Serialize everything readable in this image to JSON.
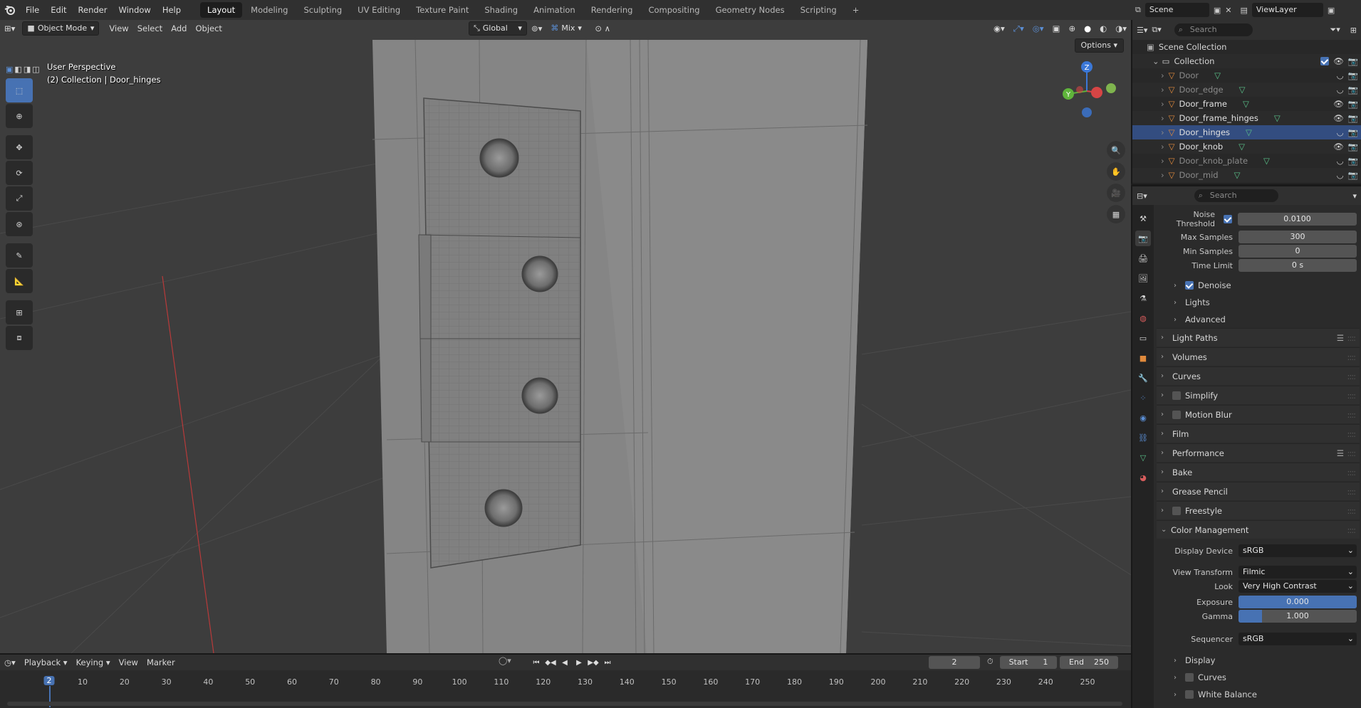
{
  "menubar": {
    "items": [
      "File",
      "Edit",
      "Render",
      "Window",
      "Help"
    ],
    "workspaces": [
      "Layout",
      "Modeling",
      "Sculpting",
      "UV Editing",
      "Texture Paint",
      "Shading",
      "Animation",
      "Rendering",
      "Compositing",
      "Geometry Nodes",
      "Scripting"
    ],
    "active_workspace": "Layout",
    "add_tab": "+"
  },
  "scenebar": {
    "scene": "Scene",
    "view_layer": "ViewLayer"
  },
  "viewport": {
    "mode": "Object Mode",
    "menus": [
      "View",
      "Select",
      "Add",
      "Object"
    ],
    "transform_orientation": "Global",
    "snap_mode": "Mix",
    "options": "Options",
    "hud_title": "User Perspective",
    "hud_subtitle": "(2) Collection | Door_hinges",
    "gizmo_axes": {
      "z": "Z",
      "y": "Y"
    }
  },
  "outliner": {
    "search_placeholder": "Search",
    "scene_collection": "Scene Collection",
    "collection": "Collection",
    "objects": [
      {
        "name": "Door",
        "visible": false,
        "selected": false
      },
      {
        "name": "Door_edge",
        "visible": false,
        "selected": false
      },
      {
        "name": "Door_frame",
        "visible": true,
        "selected": false
      },
      {
        "name": "Door_frame_hinges",
        "visible": true,
        "selected": false
      },
      {
        "name": "Door_hinges",
        "visible": false,
        "selected": true
      },
      {
        "name": "Door_knob",
        "visible": true,
        "selected": false
      },
      {
        "name": "Door_knob_plate",
        "visible": false,
        "selected": false
      },
      {
        "name": "Door_mid",
        "visible": false,
        "selected": false
      }
    ]
  },
  "properties": {
    "search_placeholder": "Search",
    "noise_threshold_label": "Noise Threshold",
    "noise_threshold": "0.0100",
    "max_samples_label": "Max Samples",
    "max_samples": "300",
    "min_samples_label": "Min Samples",
    "min_samples": "0",
    "time_limit_label": "Time Limit",
    "time_limit": "0 s",
    "sampling_subpanels": [
      {
        "label": "Denoise",
        "checkbox": true
      },
      {
        "label": "Lights",
        "checkbox": null
      },
      {
        "label": "Advanced",
        "checkbox": null
      }
    ],
    "panels": [
      {
        "label": "Light Paths",
        "checkbox": null,
        "list_icon": true
      },
      {
        "label": "Volumes",
        "checkbox": null,
        "list_icon": false
      },
      {
        "label": "Curves",
        "checkbox": null,
        "list_icon": false
      },
      {
        "label": "Simplify",
        "checkbox": false,
        "list_icon": false
      },
      {
        "label": "Motion Blur",
        "checkbox": false,
        "list_icon": false
      },
      {
        "label": "Film",
        "checkbox": null,
        "list_icon": false
      },
      {
        "label": "Performance",
        "checkbox": null,
        "list_icon": true
      },
      {
        "label": "Bake",
        "checkbox": null,
        "list_icon": false
      },
      {
        "label": "Grease Pencil",
        "checkbox": null,
        "list_icon": false
      },
      {
        "label": "Freestyle",
        "checkbox": false,
        "list_icon": false
      }
    ],
    "color_management": {
      "label": "Color Management",
      "display_device_label": "Display Device",
      "display_device": "sRGB",
      "view_transform_label": "View Transform",
      "view_transform": "Filmic",
      "look_label": "Look",
      "look": "Very High Contrast",
      "exposure_label": "Exposure",
      "exposure": "0.000",
      "gamma_label": "Gamma",
      "gamma": "1.000",
      "sequencer_label": "Sequencer",
      "sequencer": "sRGB",
      "subpanels": [
        {
          "label": "Display",
          "checkbox": null
        },
        {
          "label": "Curves",
          "checkbox": false
        },
        {
          "label": "White Balance",
          "checkbox": false
        }
      ]
    }
  },
  "timeline": {
    "menus": [
      "Playback",
      "Keying",
      "View",
      "Marker"
    ],
    "current_frame": "2",
    "start_label": "Start",
    "start": "1",
    "end_label": "End",
    "end": "250",
    "ruler": [
      "2",
      "10",
      "20",
      "30",
      "40",
      "50",
      "60",
      "70",
      "80",
      "90",
      "100",
      "110",
      "120",
      "130",
      "140",
      "150",
      "160",
      "170",
      "180",
      "190",
      "200",
      "210",
      "220",
      "230",
      "240",
      "250"
    ]
  },
  "colors": {
    "accent": "#4772b3",
    "selected_row": "#334d80",
    "object_icon": "#e08a3c",
    "mesh_data_icon": "#5ac28a"
  }
}
